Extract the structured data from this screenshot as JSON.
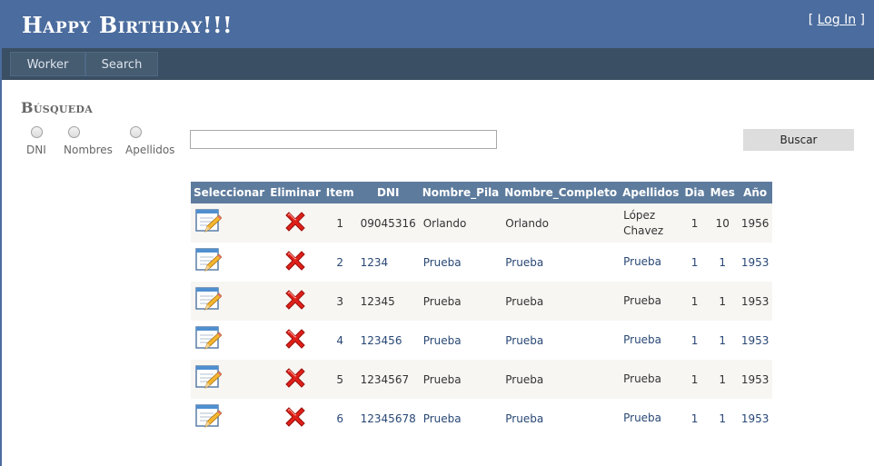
{
  "header": {
    "title": "Happy Birthday!!!",
    "login_open": "[",
    "login_label": "Log In",
    "login_close": "]"
  },
  "menu": {
    "items": [
      {
        "label": "Worker"
      },
      {
        "label": "Search"
      }
    ]
  },
  "search": {
    "heading": "Búsqueda",
    "radio_options": [
      {
        "label": "DNI"
      },
      {
        "label": "Nombres"
      },
      {
        "label": "Apellidos"
      }
    ],
    "input_value": "",
    "button_label": "Buscar"
  },
  "table": {
    "columns": [
      "Seleccionar",
      "Eliminar",
      "Item",
      "DNI",
      "Nombre_Pila",
      "Nombre_Completo",
      "Apellidos",
      "Dia",
      "Mes",
      "Año"
    ],
    "rows": [
      {
        "item": "1",
        "dni": "09045316",
        "nombre_pila": "Orlando",
        "nombre_completo": "Orlando",
        "apellidos_1": "López",
        "apellidos_2": "Chavez",
        "dia": "1",
        "mes": "10",
        "anio": "1956"
      },
      {
        "item": "2",
        "dni": "1234",
        "nombre_pila": "Prueba",
        "nombre_completo": "Prueba",
        "apellidos_1": "Prueba",
        "apellidos_2": "",
        "dia": "1",
        "mes": "1",
        "anio": "1953"
      },
      {
        "item": "3",
        "dni": "12345",
        "nombre_pila": "Prueba",
        "nombre_completo": "Prueba",
        "apellidos_1": "Prueba",
        "apellidos_2": "",
        "dia": "1",
        "mes": "1",
        "anio": "1953"
      },
      {
        "item": "4",
        "dni": "123456",
        "nombre_pila": "Prueba",
        "nombre_completo": "Prueba",
        "apellidos_1": "Prueba",
        "apellidos_2": "",
        "dia": "1",
        "mes": "1",
        "anio": "1953"
      },
      {
        "item": "5",
        "dni": "1234567",
        "nombre_pila": "Prueba",
        "nombre_completo": "Prueba",
        "apellidos_1": "Prueba",
        "apellidos_2": "",
        "dia": "1",
        "mes": "1",
        "anio": "1953"
      },
      {
        "item": "6",
        "dni": "12345678",
        "nombre_pila": "Prueba",
        "nombre_completo": "Prueba",
        "apellidos_1": "Prueba",
        "apellidos_2": "",
        "dia": "1",
        "mes": "1",
        "anio": "1953"
      }
    ],
    "select_icon": "edit-icon",
    "delete_icon": "delete-icon"
  },
  "colors": {
    "header_bg": "#4b6c9e",
    "menubar_bg": "#3a4f63",
    "table_header_bg": "#5d7b9d",
    "row_alt_bg": "#f7f6f3",
    "row_text": "#284775",
    "delete_red": "#e0201a"
  }
}
